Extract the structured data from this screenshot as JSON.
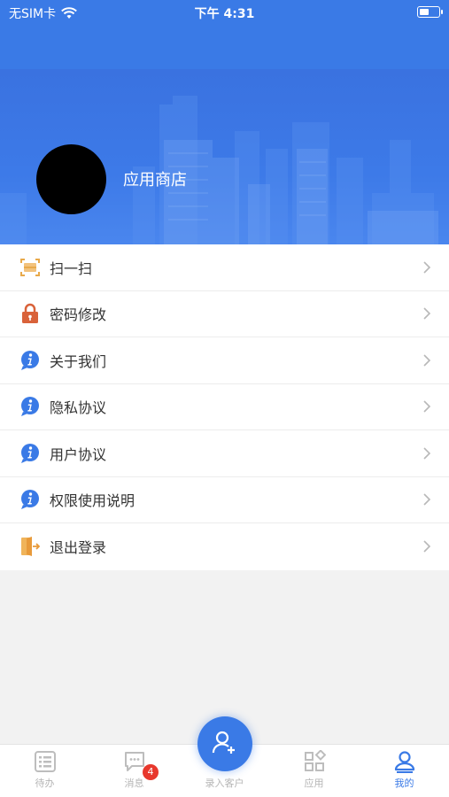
{
  "status_bar": {
    "carrier": "无SIM卡",
    "time": "下午 4:31"
  },
  "profile": {
    "name": "应用商店"
  },
  "menu": [
    {
      "label": "扫一扫",
      "icon": "scan-icon"
    },
    {
      "label": "密码修改",
      "icon": "lock-icon"
    },
    {
      "label": "关于我们",
      "icon": "info-icon"
    },
    {
      "label": "隐私协议",
      "icon": "info-icon"
    },
    {
      "label": "用户协议",
      "icon": "info-icon"
    },
    {
      "label": "权限使用说明",
      "icon": "info-icon"
    },
    {
      "label": "退出登录",
      "icon": "logout-icon"
    }
  ],
  "tabbar": {
    "items": [
      {
        "label": "待办"
      },
      {
        "label": "消息",
        "badge": "4"
      },
      {
        "label": "录入客户"
      },
      {
        "label": "应用"
      },
      {
        "label": "我的"
      }
    ]
  },
  "colors": {
    "primary": "#3a7ae6",
    "badge": "#e8382d",
    "lock": "#d9623a",
    "scan": "#e8a94a"
  }
}
